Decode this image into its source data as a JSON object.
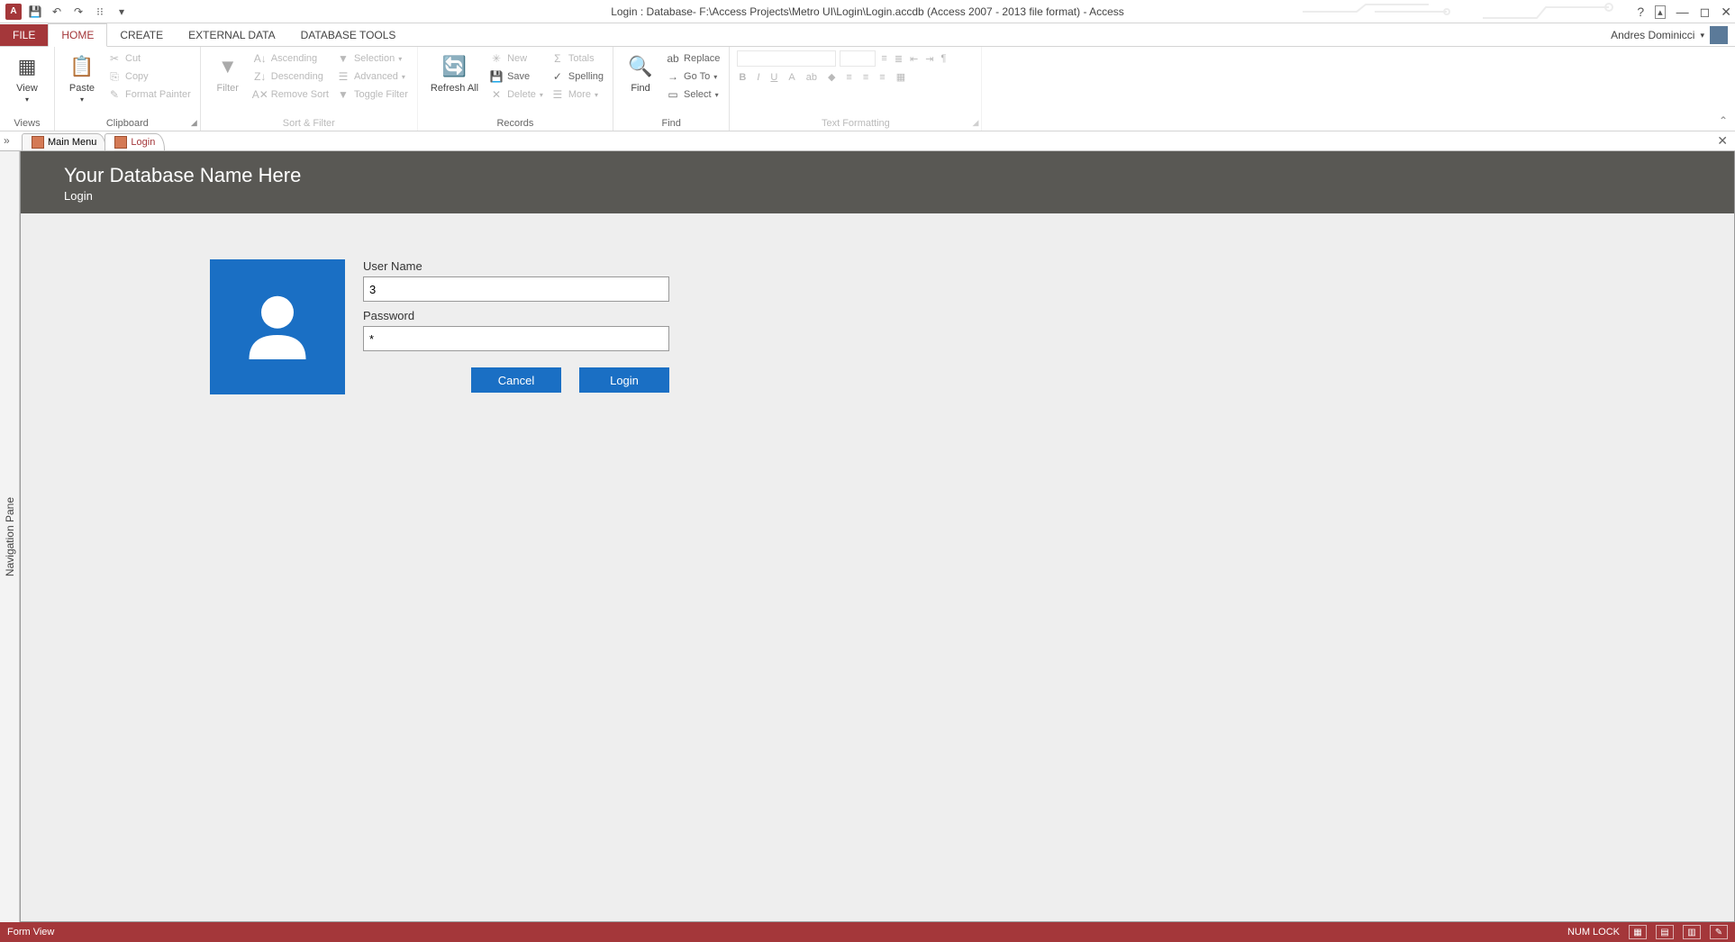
{
  "titlebar": {
    "title": "Login : Database- F:\\Access Projects\\Metro UI\\Login\\Login.accdb (Access 2007 - 2013 file format) - Access"
  },
  "tabs": {
    "file": "FILE",
    "home": "HOME",
    "create": "CREATE",
    "external": "EXTERNAL DATA",
    "dbtools": "DATABASE TOOLS"
  },
  "user": {
    "name": "Andres Dominicci"
  },
  "ribbon": {
    "views": {
      "view": "View",
      "label": "Views"
    },
    "clipboard": {
      "paste": "Paste",
      "cut": "Cut",
      "copy": "Copy",
      "format_painter": "Format Painter",
      "label": "Clipboard"
    },
    "sortfilter": {
      "filter": "Filter",
      "asc": "Ascending",
      "desc": "Descending",
      "remove": "Remove Sort",
      "selection": "Selection",
      "advanced": "Advanced",
      "toggle": "Toggle Filter",
      "label": "Sort & Filter"
    },
    "records": {
      "refresh": "Refresh All",
      "new": "New",
      "save": "Save",
      "delete": "Delete",
      "totals": "Totals",
      "spelling": "Spelling",
      "more": "More",
      "label": "Records"
    },
    "find": {
      "find": "Find",
      "replace": "Replace",
      "goto": "Go To",
      "select": "Select",
      "label": "Find"
    },
    "textfmt": {
      "label": "Text Formatting"
    }
  },
  "doctabs": {
    "main": "Main Menu",
    "login": "Login"
  },
  "navpane": {
    "label": "Navigation Pane"
  },
  "form": {
    "header_title": "Your Database Name Here",
    "header_sub": "Login",
    "username_label": "User Name",
    "username_value": "3",
    "password_label": "Password",
    "password_value": "*",
    "cancel": "Cancel",
    "login": "Login"
  },
  "statusbar": {
    "left": "Form View",
    "numlock": "NUM LOCK"
  }
}
